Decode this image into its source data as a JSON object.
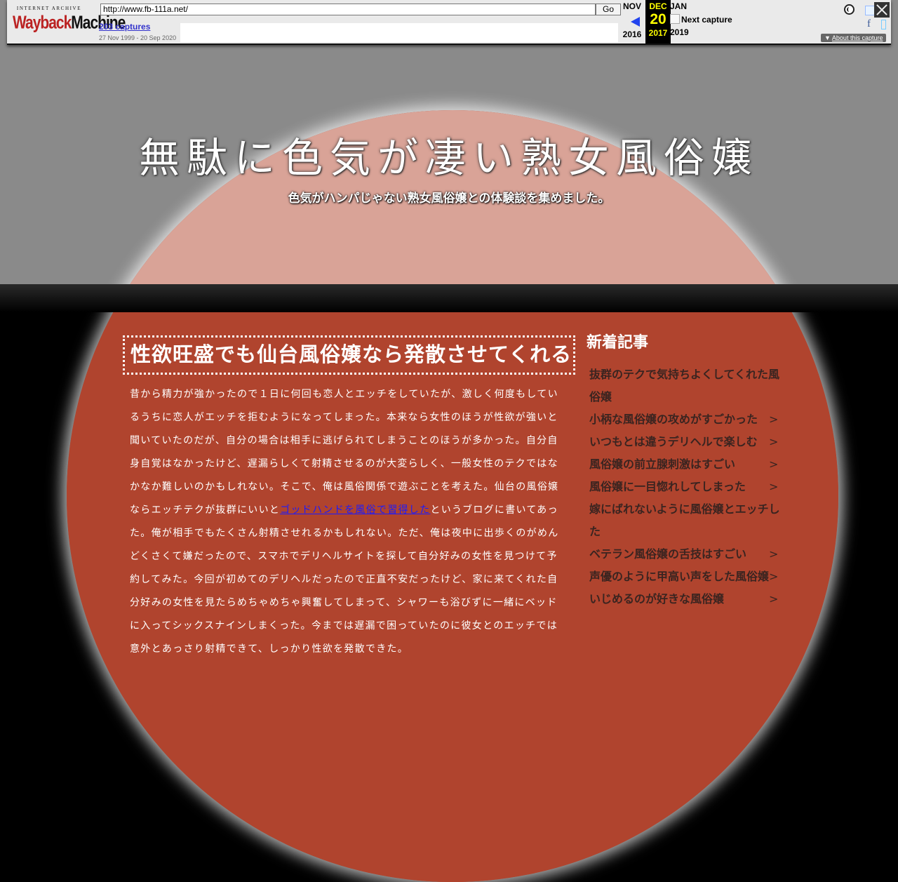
{
  "wayback": {
    "logo_top": "INTERNET ARCHIVE",
    "logo_main_a": "Wayback",
    "logo_main_b": "Machine",
    "url": "http://www.fb-111a.net/",
    "go_label": "Go",
    "captures": "203 captures",
    "range": "27 Nov 1999 - 20 Sep 2020",
    "prev_month": "NOV",
    "prev_year": "2016",
    "cur_month": "DEC",
    "cur_day": "20",
    "cur_year": "2017",
    "next_month": "JAN",
    "next_year": "2019",
    "next_capture": "Next capture",
    "facebook": "f",
    "about_label": "About this capture",
    "colors": {
      "bar_bg": "#eaeaea",
      "current_bg": "#000000",
      "current_fg": "#ffff00",
      "arrow": "#2244ee"
    },
    "icons": {
      "help": "help-circle-icon",
      "close": "close-icon",
      "twitter": "twitter-icon",
      "facebook": "facebook-icon",
      "share": "share-icon",
      "prev": "arrow-left-icon"
    }
  },
  "site": {
    "title": "無駄に色気が凄い熟女風俗嬢",
    "subtitle": "色気がハンパじゃない熟女風俗嬢との体験談を集めました。",
    "colors": {
      "bg_top": "#8a8a8a",
      "bg_bottom": "#000000",
      "circle_top": "#d9a397",
      "circle": "#b0442e"
    }
  },
  "article": {
    "title": "性欲旺盛でも仙台風俗嬢なら発散させてくれる",
    "body_before_link": "昔から精力が強かったので１日に何回も恋人とエッチをしていたが、激しく何度もしているうちに恋人がエッチを拒むようになってしまった。本来なら女性のほうが性欲が強いと聞いていたのだが、自分の場合は相手に逃げられてしまうことのほうが多かった。自分自身自覚はなかったけど、遅漏らしくて射精させるのが大変らしく、一般女性のテクではなかなか難しいのかもしれない。そこで、俺は風俗関係で遊ぶことを考えた。仙台の風俗嬢ならエッチテクが抜群にいいと",
    "link_text": "ゴッドハンドを風俗で習得した",
    "body_after_link": "というブログに書いてあった。俺が相手でもたくさん射精させれるかもしれない。ただ、俺は夜中に出歩くのがめんどくさくて嫌だったので、スマホでデリヘルサイトを探して自分好みの女性を見つけて予約してみた。今回が初めてのデリヘルだったので正直不安だったけど、家に来てくれた自分好みの女性を見たらめちゃめちゃ興奮してしまって、シャワーも浴びずに一緒にベッドに入ってシックスナインしまくった。今までは遅漏で困っていたのに彼女とのエッチでは意外とあっさり射精できて、しっかり性欲を発散できた。"
  },
  "sidebar": {
    "heading": "新着記事",
    "arrow": ">",
    "items": [
      {
        "label": "抜群のテクで気持ちよくしてくれた風俗嬢"
      },
      {
        "label": "小柄な風俗嬢の攻めがすごかった"
      },
      {
        "label": "いつもとは違うデリヘルで楽しむ"
      },
      {
        "label": "風俗嬢の前立腺刺激はすごい"
      },
      {
        "label": "風俗嬢に一目惚れしてしまった"
      },
      {
        "label": "嫁にばれないように風俗嬢とエッチした"
      },
      {
        "label": "ベテラン風俗嬢の舌技はすごい"
      },
      {
        "label": "声優のように甲高い声をした風俗嬢"
      },
      {
        "label": "いじめるのが好きな風俗嬢"
      }
    ]
  }
}
